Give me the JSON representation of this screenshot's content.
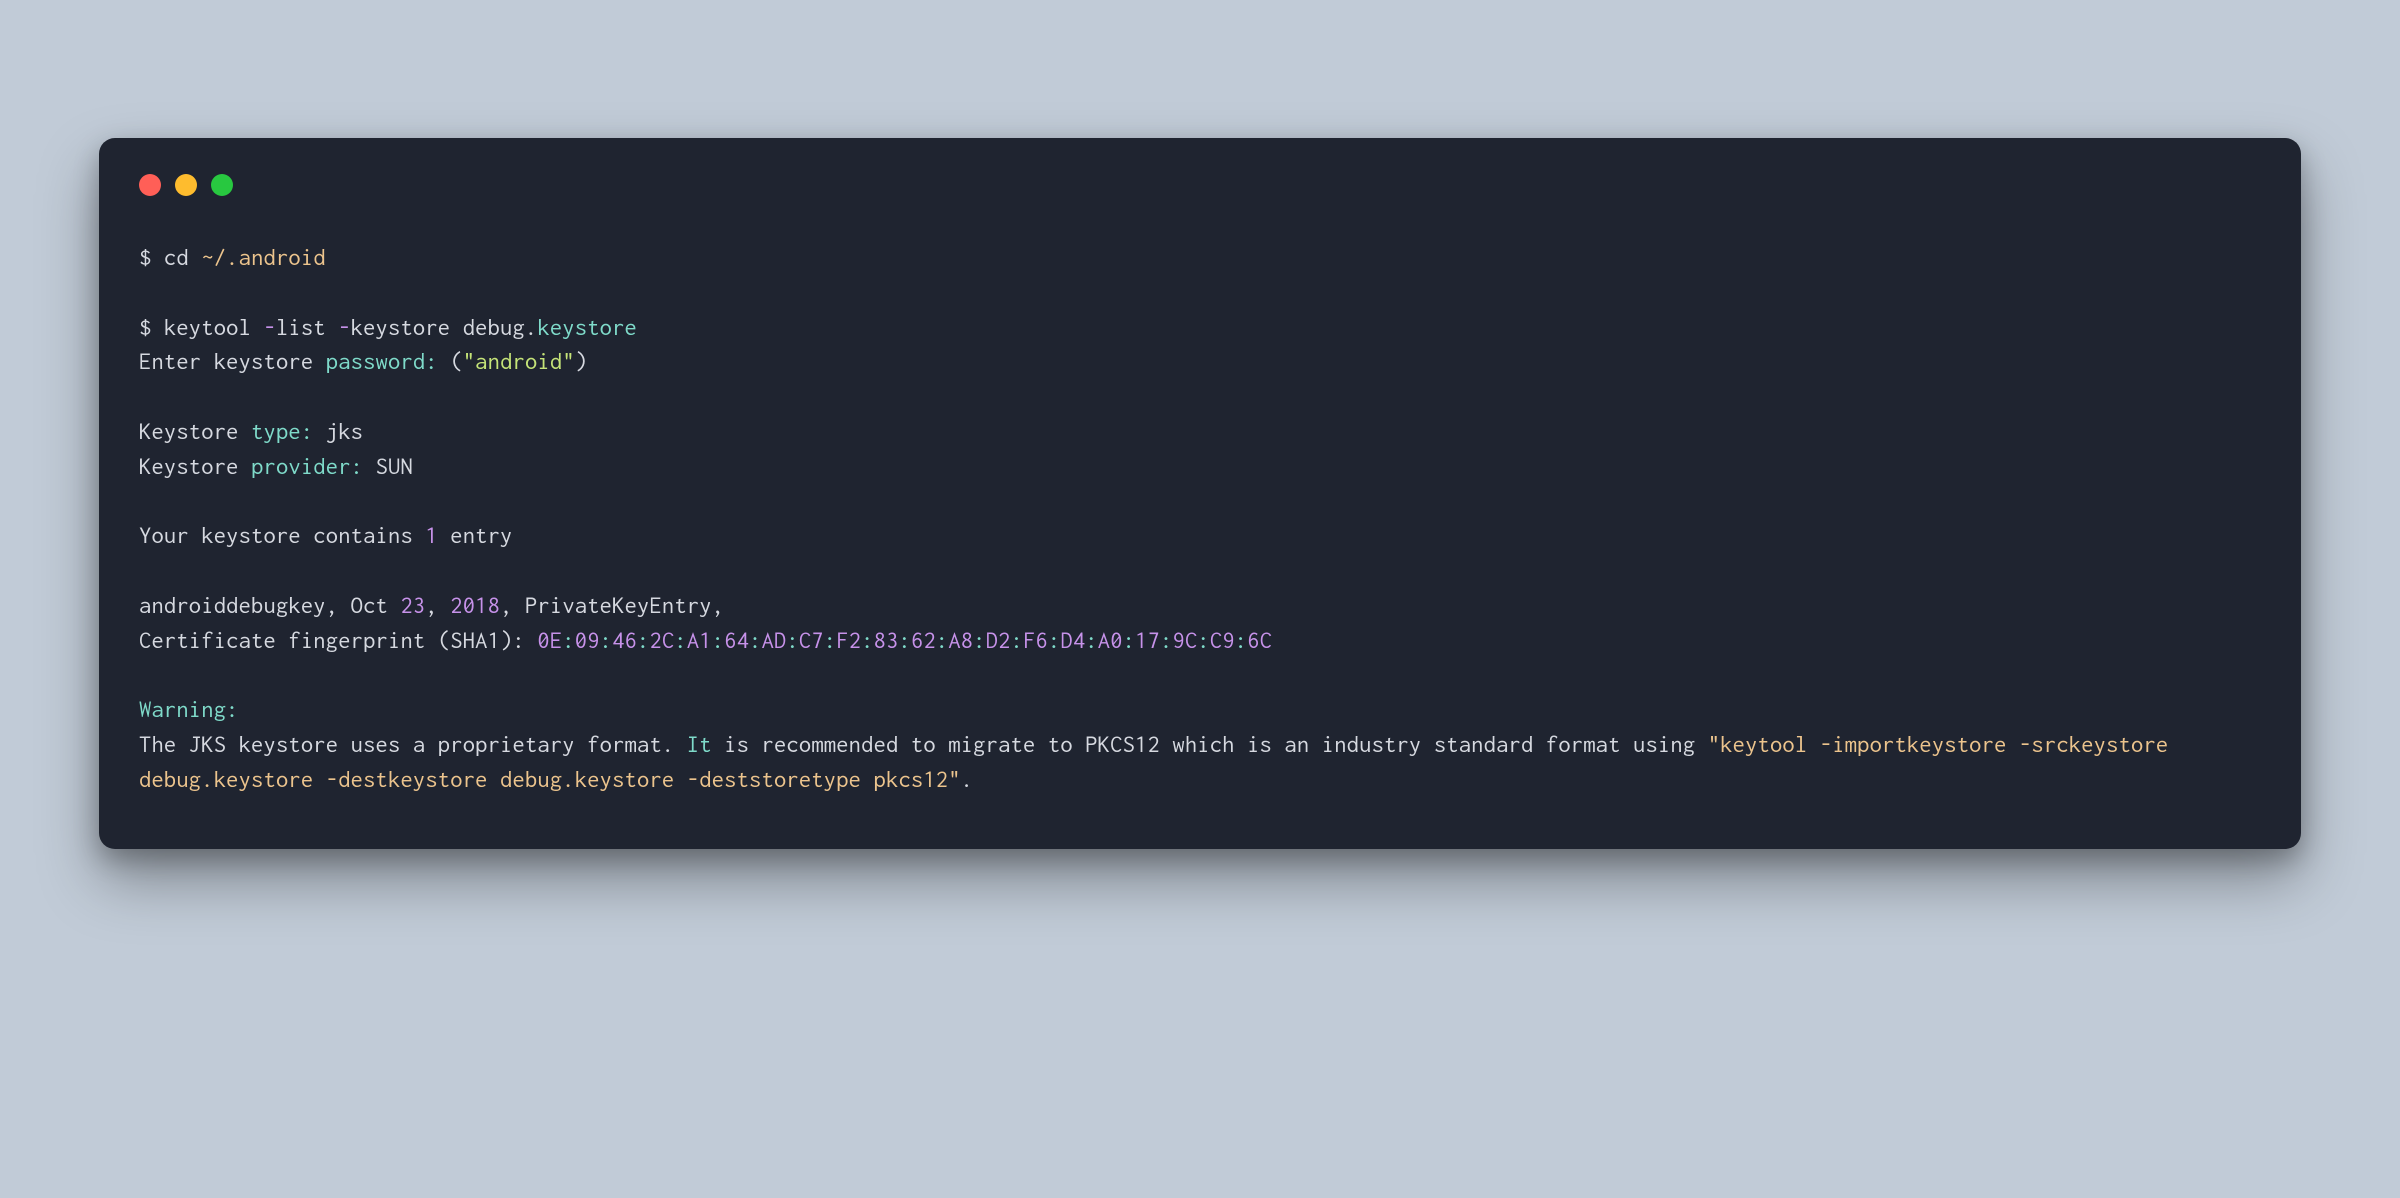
{
  "line1": {
    "prompt": "$ ",
    "cmd": "cd ",
    "path": "~/.android"
  },
  "line2": {
    "prompt": "$ keytool ",
    "dash1": "-",
    "list": "list ",
    "dash2": "-",
    "keystore": "keystore debug.",
    "keystoreword": "keystore"
  },
  "line3": {
    "pre": "Enter keystore ",
    "pass": "password",
    "colon": ": ",
    "paren_open": "(",
    "str": "\"android\"",
    "paren_close": ")"
  },
  "line4": {
    "pre": "Keystore ",
    "type": "type",
    "colon": ":",
    "rest": " jks"
  },
  "line5": {
    "pre": "Keystore ",
    "provider": "provider",
    "colon": ":",
    "rest": " SUN"
  },
  "line6": {
    "pre": "Your keystore contains ",
    "num": "1",
    "rest": " entry"
  },
  "line7": {
    "pre": "androiddebugkey, Oct ",
    "n1": "23",
    "comma": ", ",
    "n2": "2018",
    "rest": ", PrivateKeyEntry,"
  },
  "line8": {
    "pre": "Certificate fingerprint (SHA1): ",
    "fp": [
      {
        "h": "0E",
        "last": false
      },
      {
        "h": "09",
        "last": false
      },
      {
        "h": "46",
        "last": false
      },
      {
        "h": "2",
        "last": false,
        "plainTail": "C"
      },
      {
        "h": "A1",
        "last": false
      },
      {
        "h": "64",
        "last": false
      },
      {
        "h": "AD",
        "last": false
      },
      {
        "h": "C7",
        "last": false
      },
      {
        "h": "F2",
        "last": false
      },
      {
        "h": "83",
        "last": false
      },
      {
        "h": "62",
        "last": false
      },
      {
        "h": "A8",
        "last": false
      },
      {
        "h": "D2",
        "last": false
      },
      {
        "h": "F6",
        "last": false
      },
      {
        "h": "D4",
        "last": false
      },
      {
        "h": "A0",
        "last": false
      },
      {
        "h": "17",
        "last": false
      },
      {
        "h": "9",
        "last": false,
        "plainTail": "C"
      },
      {
        "h": "C9",
        "last": false
      },
      {
        "h": "6",
        "last": true,
        "plainTail": "C"
      }
    ]
  },
  "line9": {
    "warning": "Warning",
    "colon": ":"
  },
  "line10": {
    "pre": "The JKS keystore uses a proprietary format. ",
    "it": "It",
    "mid": " is recommended to migrate to PKCS12 which is an industry standard format using ",
    "q1": "\"keytool -importkeystore -srckeystore debug.keystore -destkeystore debug.keystore -deststoretype pkcs12\"",
    "end": "."
  }
}
